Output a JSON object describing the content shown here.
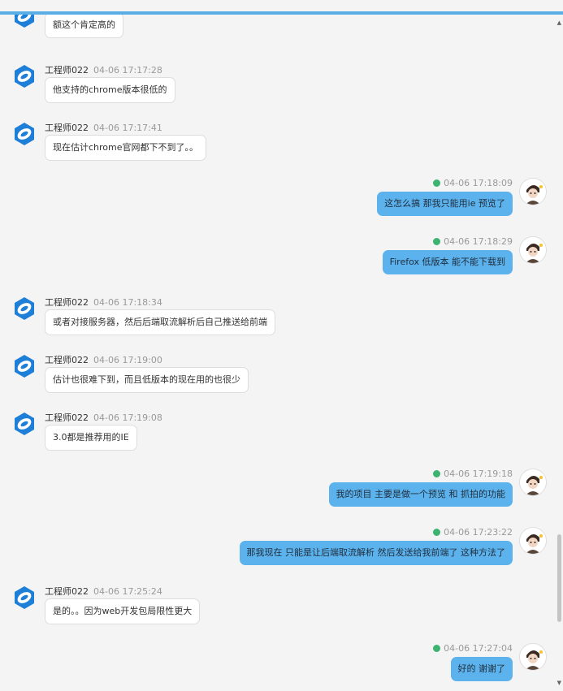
{
  "colors": {
    "accent": "#5aaee6",
    "outgoing_bubble": "#5cb2ec",
    "incoming_bubble": "#ffffff",
    "status_ok": "#3cb371"
  },
  "messages": [
    {
      "side": "left",
      "sender": "",
      "time": "",
      "text": "额这个肯定高的"
    },
    {
      "side": "left",
      "sender": "工程师022",
      "time": "04-06 17:17:28",
      "text": "他支持的chrome版本很低的"
    },
    {
      "side": "left",
      "sender": "工程师022",
      "time": "04-06 17:17:41",
      "text": "现在估计chrome官网都下不到了。。"
    },
    {
      "side": "right",
      "time": "04-06 17:18:09",
      "text": "这怎么搞 那我只能用ie 预览了"
    },
    {
      "side": "right",
      "time": "04-06 17:18:29",
      "text": "Firefox 低版本 能不能下载到"
    },
    {
      "side": "left",
      "sender": "工程师022",
      "time": "04-06 17:18:34",
      "text": "或者对接服务器，然后后端取流解析后自己推送给前端"
    },
    {
      "side": "left",
      "sender": "工程师022",
      "time": "04-06 17:19:00",
      "text": "估计也很难下到，而且低版本的现在用的也很少"
    },
    {
      "side": "left",
      "sender": "工程师022",
      "time": "04-06 17:19:08",
      "text": "3.0都是推荐用的IE"
    },
    {
      "side": "right",
      "time": "04-06 17:19:18",
      "text": "我的项目 主要是做一个预览 和 抓拍的功能"
    },
    {
      "side": "right",
      "time": "04-06 17:23:22",
      "text": "那我现在 只能是让后端取流解析 然后发送给我前端了 这种方法了"
    },
    {
      "side": "left",
      "sender": "工程师022",
      "time": "04-06 17:25:24",
      "text": "是的。。因为web开发包局限性更大"
    },
    {
      "side": "right",
      "time": "04-06 17:27:04",
      "text": "好的 谢谢了"
    }
  ]
}
